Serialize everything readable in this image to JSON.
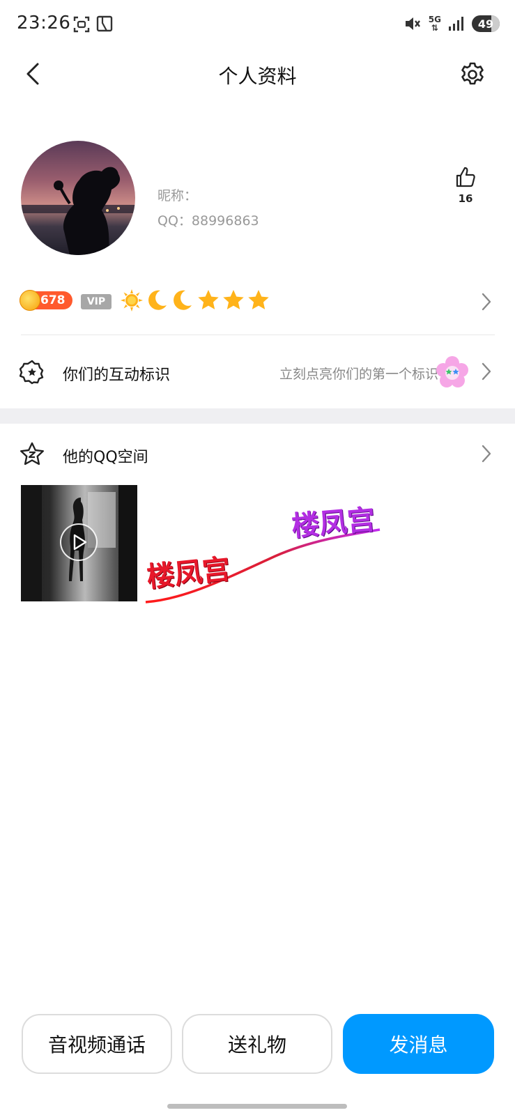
{
  "status_bar": {
    "time": "23:26",
    "network": "5G",
    "battery": "49",
    "icons": [
      "screenshot-icon",
      "sim-icon",
      "mute-icon",
      "signal-icon"
    ]
  },
  "header": {
    "title": "个人资料",
    "back_icon": "chevron-left-icon",
    "settings_icon": "gear-icon"
  },
  "profile": {
    "nickname_label": "昵称：",
    "qq_line": "QQ：88996863",
    "likes": "16"
  },
  "badges": {
    "level": "678",
    "vip": "VIP",
    "grade_icons": [
      "sun",
      "moon",
      "moon",
      "star",
      "star",
      "star"
    ]
  },
  "interaction": {
    "title": "你们的互动标识",
    "hint": "立刻点亮你们的第一个标识"
  },
  "qzone": {
    "title": "他的QQ空间"
  },
  "watermark": {
    "text1": "楼凤宫",
    "text2": "楼凤宫"
  },
  "actions": {
    "call": "音视频通话",
    "gift": "送礼物",
    "message": "发消息"
  },
  "colors": {
    "primary": "#0099ff",
    "level_badge": "#ff5a2d",
    "vip_badge": "#a7a7a7",
    "section_gap": "#efeff2"
  }
}
